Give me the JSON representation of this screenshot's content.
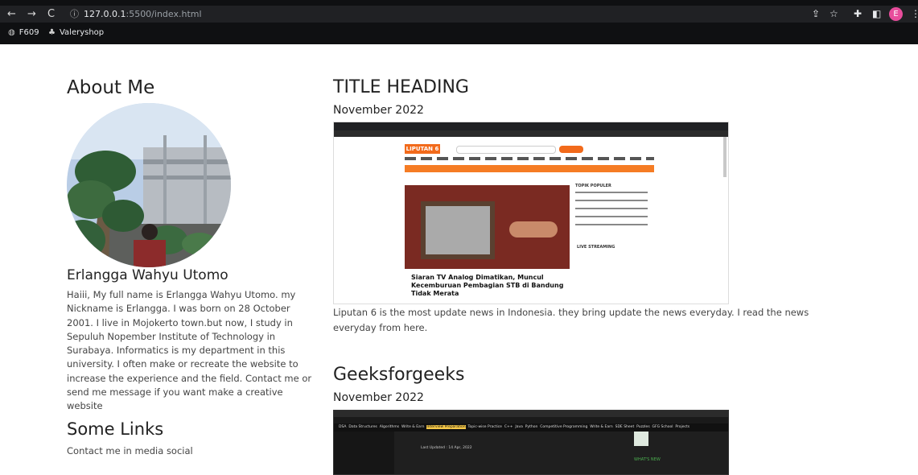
{
  "browser": {
    "url_host": "127.0.0.1",
    "url_path": ":5500/index.html",
    "profile_initial": "E",
    "bookmarks": [
      "F609",
      "Valeryshop"
    ]
  },
  "left": {
    "about_heading": "About Me",
    "name": "Erlangga Wahyu Utomo",
    "bio": "Haiii, My full name is Erlangga Wahyu Utomo. my Nickname is Erlangga. I was born on 28 October 2001. I live in Mojokerto town.but now, I study in Sepuluh Nopember Institute of Technology in Surabaya. Informatics is my department in this university. I often make or recreate the website to increase the experience and the field. Contact me or send me message if you want make a creative website",
    "links_heading": "Some Links",
    "links_text": "Contact me in media social"
  },
  "posts": [
    {
      "title": "TITLE HEADING",
      "date": "November 2022",
      "description": "Liputan 6 is the most update news in Indonesia. they bring update the news everyday. I read the news everyday from here.",
      "screenshot": {
        "logo": "LIPUTAN 6",
        "headline": "Siaran TV Analog Dimatikan, Muncul Kecemburuan Pembagian STB di Bandung Tidak Merata",
        "side_title": "TOPIK POPULER",
        "live": "LIVE STREAMING"
      }
    },
    {
      "title": "Geeksforgeeks",
      "date": "November 2022",
      "screenshot": {
        "menu": [
          "DSA",
          "Data Structures",
          "Algorithms",
          "Write & Earn",
          "Interview Preparation",
          "Topic-wise Practice",
          "C++",
          "Java",
          "Python",
          "Competitive Programming",
          "Write & Earn",
          "SDE Sheet",
          "Puzzles",
          "GFG School",
          "Projects"
        ],
        "updated": "Last Updated : 14 Apr, 2022",
        "whats_new": "WHAT'S NEW"
      }
    }
  ]
}
